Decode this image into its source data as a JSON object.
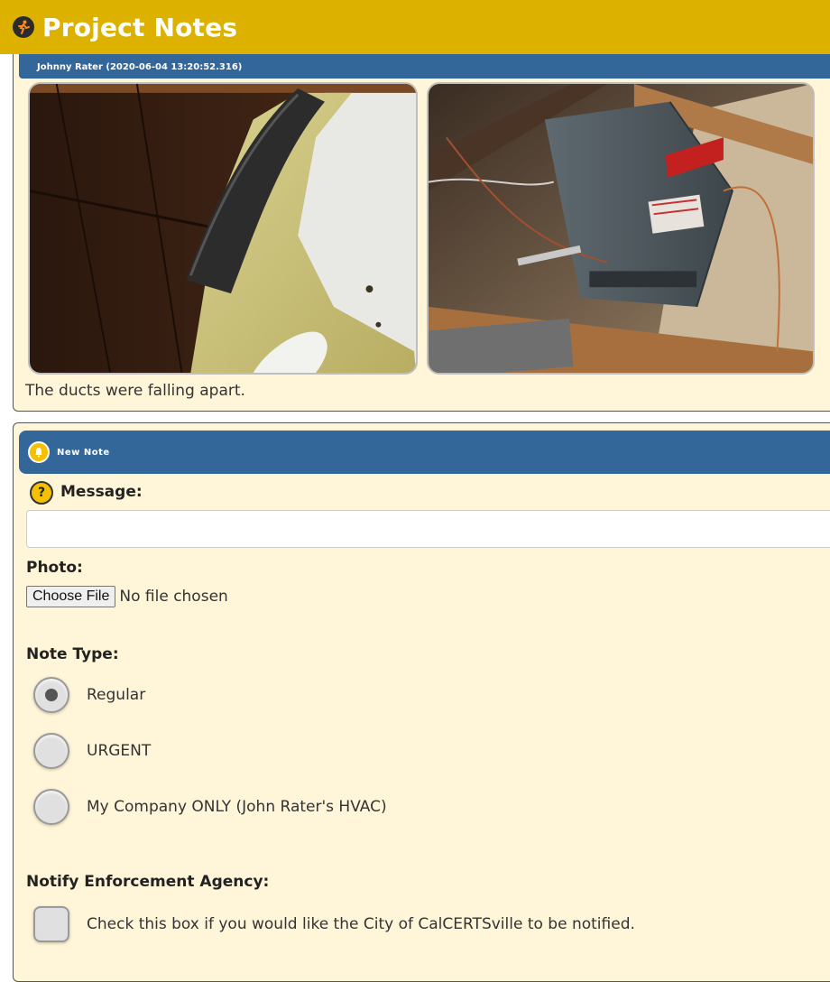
{
  "header": {
    "title": "Project Notes",
    "logo_icon": "runner-logo-icon",
    "bg_color": "#ddb100"
  },
  "previous_note": {
    "author_line": "Johnny Rater (2020-06-04 13:20:52.316)",
    "photos": [
      {
        "subject": "attic-ducts-insulation"
      },
      {
        "subject": "attic-furnace"
      }
    ],
    "text": "The ducts were falling apart."
  },
  "new_note": {
    "section_title": "New Note",
    "section_icon": "bell-icon",
    "help_icon_glyph": "?",
    "message": {
      "label": "Message:",
      "value": "",
      "placeholder": ""
    },
    "photo": {
      "label": "Photo:",
      "button_label": "Choose File",
      "status": "No file chosen"
    },
    "note_type": {
      "label": "Note Type:",
      "options": [
        {
          "label": "Regular",
          "selected": true
        },
        {
          "label": "URGENT",
          "selected": false
        },
        {
          "label": "My Company ONLY (John Rater's HVAC)",
          "selected": false
        }
      ]
    },
    "notify": {
      "label": "Notify Enforcement Agency:",
      "checkbox_label": "Check this box if you would like the City of CalCERTSville to be notified.",
      "checked": false
    }
  },
  "colors": {
    "panel_header": "#336699",
    "panel_bg": "#fff5d8",
    "accent": "#f5c000"
  }
}
